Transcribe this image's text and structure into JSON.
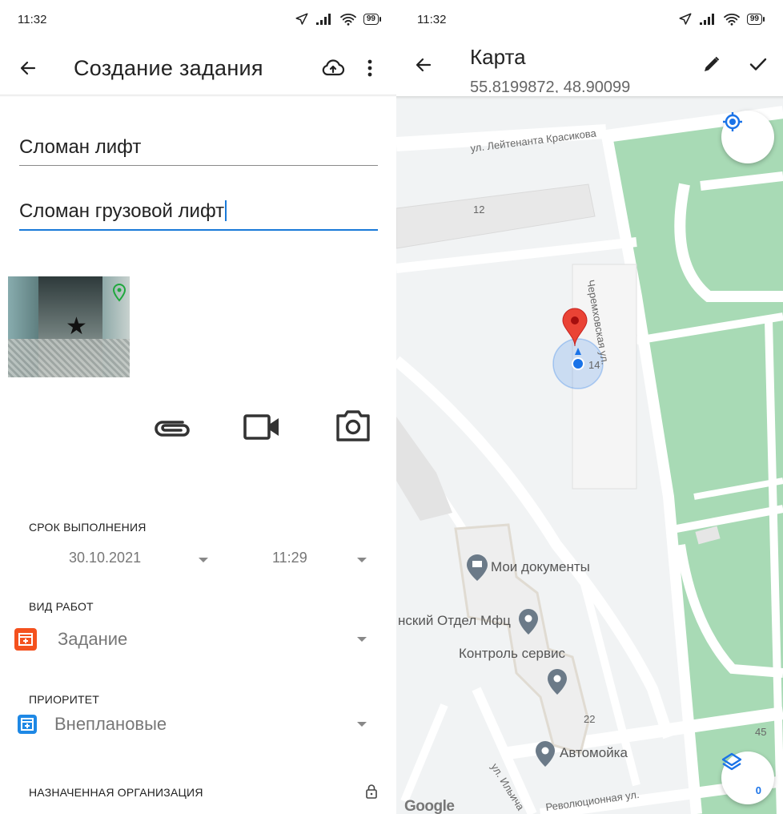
{
  "left": {
    "status": {
      "time": "11:32",
      "battery": "99"
    },
    "appbar": {
      "title": "Создание задания"
    },
    "fields": {
      "task_title": "Сломан лифт",
      "task_description": "Сломан грузовой лифт"
    },
    "deadline": {
      "label": "СРОК ВЫПОЛНЕНИЯ",
      "date": "30.10.2021",
      "time": "11:29"
    },
    "work_type": {
      "label": "ВИД РАБОТ",
      "value": "Задание",
      "icon_color": "#f4511e"
    },
    "priority": {
      "label": "ПРИОРИТЕТ",
      "value": "Внеплановые",
      "icon_color": "#1e88e5"
    },
    "assigned_org": {
      "label": "НАЗНАЧЕННАЯ ОРГАНИЗАЦИЯ"
    }
  },
  "right": {
    "status": {
      "time": "11:32",
      "battery": "99"
    },
    "appbar": {
      "title": "Карта",
      "coords": "55.8199872, 48.90099"
    },
    "map": {
      "streets": {
        "krasikova": "ул. Лейтенанта Красикова",
        "cheremhovskaya": "Черемховская ул.",
        "ilyicha": "ул. Ильича",
        "revolutsionnaya": "Революционная ул."
      },
      "house_numbers": {
        "n12": "12",
        "n14": "14",
        "n22": "22",
        "n45": "45"
      },
      "pois": {
        "moi_dokumenty": "Мои документы",
        "mfc": "нский Отдел Мфц",
        "kontrol_servis": "Контроль сервис",
        "avtomoyka": "Автомойка"
      },
      "layers_count": "0",
      "logo": "Google"
    },
    "colors": {
      "park": "#a8dab5",
      "marker": "#ea4335",
      "accent": "#1a73e8"
    }
  }
}
